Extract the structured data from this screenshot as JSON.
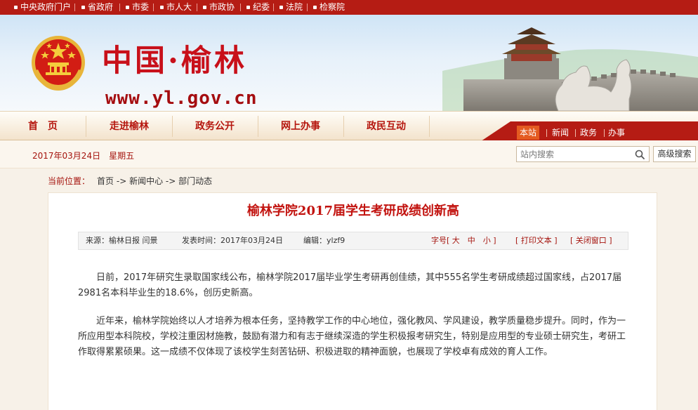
{
  "topbar": {
    "links": [
      "中央政府门户",
      "省政府",
      "市委",
      "市人大",
      "市政协",
      "纪委",
      "法院",
      "检察院"
    ]
  },
  "banner": {
    "title": "中国·榆林",
    "url": "www.yl.gov.cn"
  },
  "nav": {
    "items": [
      "首　页",
      "走进榆林",
      "政务公开",
      "网上办事",
      "政民互动"
    ],
    "subnav": [
      "本站",
      "新闻",
      "政务",
      "办事"
    ]
  },
  "daterow": {
    "date": "2017年03月24日　星期五",
    "search_placeholder": "站内搜索",
    "advanced_label": "高级搜索"
  },
  "breadcrumb": {
    "label": "当前位置：",
    "items": [
      "首页",
      "->",
      "新闻中心",
      "->",
      "部门动态"
    ]
  },
  "article": {
    "title": "榆林学院2017届学生考研成绩创新高",
    "meta": {
      "source": "来源：榆林日报 闫景",
      "published": "发表时间：2017年03月24日",
      "editor": "编辑：ylzf9",
      "font_size": "字号[ 大　中　小 ]",
      "print": "[ 打印文本 ]",
      "close": "[ 关闭窗口 ]"
    },
    "paragraphs": [
      "日前，2017年研究生录取国家线公布，榆林学院2017届毕业学生考研再创佳绩，其中555名学生考研成绩超过国家线，占2017届2981名本科毕业生的18.6%，创历史新高。",
      "近年来，榆林学院始终以人才培养为根本任务，坚持教学工作的中心地位，强化教风、学风建设，教学质量稳步提升。同时，作为一所应用型本科院校，学校注重因材施教，鼓励有潜力和有志于继续深造的学生积极报考研究生，特别是应用型的专业硕士研究生，考研工作取得累累硕果。这一成绩不仅体现了该校学生刻苦钻研、积极进取的精神面貌，也展现了学校卓有成效的育人工作。"
    ]
  },
  "colors": {
    "brand_red": "#b51c14",
    "title_red": "#c2130f",
    "accent_orange": "#e45b21"
  },
  "icons": [
    "dot-icon",
    "emblem-icon",
    "search-icon"
  ]
}
